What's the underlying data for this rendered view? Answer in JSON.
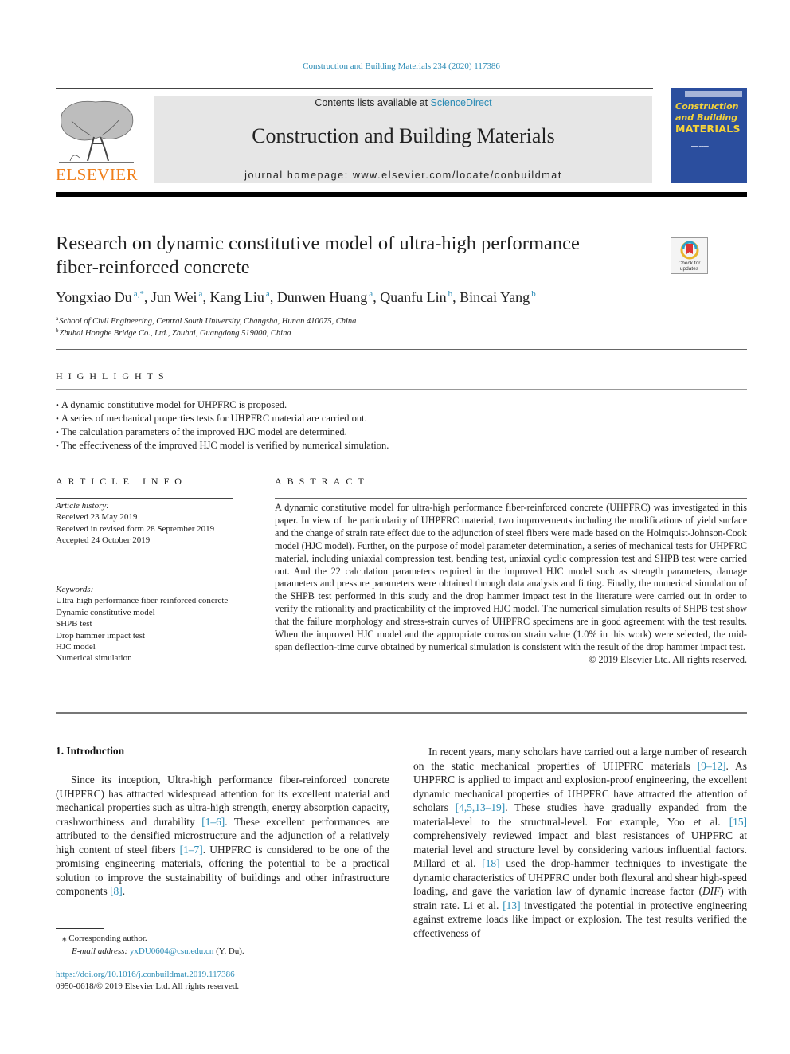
{
  "header": {
    "journal_reference": "Construction and Building Materials 234 (2020) 117386",
    "publisher_logo_text": "ELSEVIER",
    "contents_prefix": "Contents lists available at ",
    "contents_link": "ScienceDirect",
    "journal_title": "Construction and Building Materials",
    "homepage": "journal homepage: www.elsevier.com/locate/conbuildmat",
    "cover": {
      "line1": "Construction",
      "line2": "and Building",
      "line3": "MATERIALS"
    },
    "colors": {
      "link": "#2a8bb5",
      "elsevier_orange": "#f07f1a",
      "cover_blue": "#2b4e9e",
      "cover_yellow": "#f4d23a"
    }
  },
  "article": {
    "title_line1": "Research on dynamic constitutive model of ultra-high performance",
    "title_line2": "fiber-reinforced concrete",
    "check_updates": {
      "line1": "Check for",
      "line2": "updates"
    },
    "authors": [
      {
        "name": "Yongxiao Du",
        "sup": "a,*"
      },
      {
        "name": "Jun Wei",
        "sup": "a"
      },
      {
        "name": "Kang Liu",
        "sup": "a"
      },
      {
        "name": "Dunwen Huang",
        "sup": "a"
      },
      {
        "name": "Quanfu Lin",
        "sup": "b"
      },
      {
        "name": "Bincai Yang",
        "sup": "b"
      }
    ],
    "affiliations": [
      {
        "mark": "a",
        "text": "School of Civil Engineering, Central South University, Changsha, Hunan 410075, China"
      },
      {
        "mark": "b",
        "text": "Zhuhai Honghe Bridge Co., Ltd., Zhuhai, Guangdong 519000, China"
      }
    ]
  },
  "highlights": {
    "heading": "HIGHLIGHTS",
    "items": [
      "A dynamic constitutive model for UHPFRC is proposed.",
      "A series of mechanical properties tests for UHPFRC material are carried out.",
      "The calculation parameters of the improved HJC model are determined.",
      "The effectiveness of the improved HJC model is verified by numerical simulation."
    ]
  },
  "article_info": {
    "heading": "ARTICLE INFO",
    "history_label": "Article history:",
    "history": [
      "Received 23 May 2019",
      "Received in revised form 28 September 2019",
      "Accepted 24 October 2019"
    ],
    "keywords_label": "Keywords:",
    "keywords": [
      "Ultra-high performance fiber-reinforced concrete",
      "Dynamic constitutive model",
      "SHPB test",
      "Drop hammer impact test",
      "HJC model",
      "Numerical simulation"
    ]
  },
  "abstract": {
    "heading": "ABSTRACT",
    "text": "A dynamic constitutive model for ultra-high performance fiber-reinforced concrete (UHPFRC) was investigated in this paper. In view of the particularity of UHPFRC material, two improvements including the modifications of yield surface and the change of strain rate effect due to the adjunction of steel fibers were made based on the Holmquist-Johnson-Cook model (HJC model). Further, on the purpose of model parameter determination, a series of mechanical tests for UHPFRC material, including uniaxial compression test, bending test, uniaxial cyclic compression test and SHPB test were carried out. And the 22 calculation parameters required in the improved HJC model such as strength parameters, damage parameters and pressure parameters were obtained through data analysis and fitting. Finally, the numerical simulation of the SHPB test performed in this study and the drop hammer impact test in the literature were carried out in order to verify the rationality and practicability of the improved HJC model. The numerical simulation results of SHPB test show that the failure morphology and stress-strain curves of UHPFRC specimens are in good agreement with the test results. When the improved HJC model and the appropriate corrosion strain value (1.0% in this work) were selected, the mid-span deflection-time curve obtained by numerical simulation is consistent with the result of the drop hammer impact test.",
    "copyright": "© 2019 Elsevier Ltd. All rights reserved."
  },
  "body": {
    "intro_heading": "1. Introduction",
    "left_para": [
      {
        "t": "Since its inception, Ultra-high performance fiber-reinforced concrete (UHPFRC) has attracted widespread attention for its excellent material and mechanical properties such as ultra-high strength, energy absorption capacity, crashworthiness and durability "
      },
      {
        "ref": "[1–6]"
      },
      {
        "t": ". These excellent performances are attributed to the densified microstructure and the adjunction of a relatively high content of steel fibers "
      },
      {
        "ref": "[1–7]"
      },
      {
        "t": ". UHPFRC is considered to be one of the promising engineering materials, offering the potential to be a practical solution to improve the sustainability of buildings and other infrastructure components "
      },
      {
        "ref": "[8]"
      },
      {
        "t": "."
      }
    ],
    "right_para": [
      {
        "t": "In recent years, many scholars have carried out a large number of research on the static mechanical properties of UHPFRC materials "
      },
      {
        "ref": "[9–12]"
      },
      {
        "t": ". As UHPFRC is applied to impact and explosion-proof engineering, the excellent dynamic mechanical properties of UHPFRC have attracted the attention of scholars "
      },
      {
        "ref": "[4,5,13–19]"
      },
      {
        "t": ". These studies have gradually expanded from the material-level to the structural-level. For example, Yoo et al. "
      },
      {
        "ref": "[15]"
      },
      {
        "t": " comprehensively reviewed impact and blast resistances of UHPFRC at material level and structure level by considering various influential factors. Millard et al. "
      },
      {
        "ref": "[18]"
      },
      {
        "t": " used the drop-hammer techniques to investigate the dynamic characteristics of UHPFRC under both flexural and shear high-speed loading, and gave the variation law of dynamic increase factor ("
      },
      {
        "i": "DIF"
      },
      {
        "t": ") with strain rate. Li et al. "
      },
      {
        "ref": "[13]"
      },
      {
        "t": " investigated the potential in protective engineering against extreme loads like impact or explosion. The test results verified the effectiveness of"
      }
    ]
  },
  "footnotes": {
    "corresponding_mark": "⁎",
    "corresponding": "Corresponding author.",
    "email_label": "E-mail address:",
    "email": "yxDU0604@csu.edu.cn",
    "email_suffix": " (Y. Du).",
    "doi": "https://doi.org/10.1016/j.conbuildmat.2019.117386",
    "issn_line": "0950-0618/© 2019 Elsevier Ltd. All rights reserved."
  }
}
